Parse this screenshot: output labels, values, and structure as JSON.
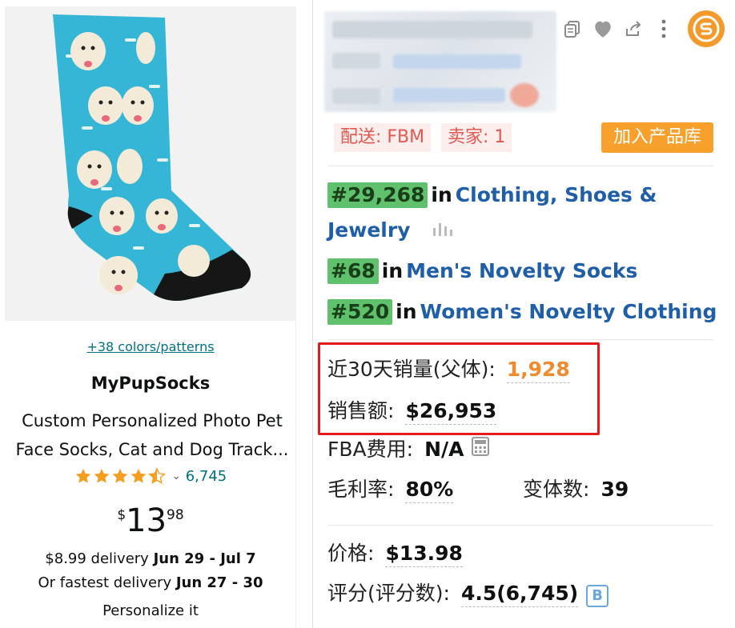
{
  "product": {
    "swatches_link": "+38 colors/patterns",
    "brand": "MyPupSocks",
    "title_line1": "Custom Personalized Photo Pet",
    "title_line2": "Face Socks, Cat and Dog Track...",
    "rating": 4.5,
    "review_count": "6,745",
    "price": {
      "currency": "$",
      "whole": "13",
      "fraction": "98"
    },
    "delivery": {
      "prefix": "$8.99 delivery ",
      "dates": "Jun 29 - Jul 7"
    },
    "fastest": {
      "prefix": "Or fastest delivery ",
      "dates": "Jun 27 - 30"
    },
    "personalize": "Personalize it"
  },
  "panel": {
    "tags": {
      "fulfillment": "配送: FBM",
      "sellers": "卖家: 1"
    },
    "add_button": "加入产品库",
    "ranks": [
      {
        "rank": "#29,268",
        "in": "in",
        "category_line1": "Clothing, Shoes &",
        "category_line2": "Jewelry"
      },
      {
        "rank": "#68",
        "in": "in",
        "category": "Men's Novelty Socks"
      },
      {
        "rank": "#520",
        "in": "in",
        "category": "Women's Novelty Clothing"
      }
    ],
    "stats": {
      "sales_30d_label": "近30天销量(父体):",
      "sales_30d_value": "1,928",
      "revenue_label": "销售额:",
      "revenue_value": "$26,953",
      "fba_fee_label": "FBA费用:",
      "fba_fee_value": "N/A",
      "margin_label": "毛利率:",
      "margin_value": "80%",
      "variants_label": "变体数:",
      "variants_value": "39",
      "price_label": "价格:",
      "price_value": "$13.98",
      "rating_label": "评分(评分数):",
      "rating_value": "4.5(6,745)",
      "rating_badge": "B"
    },
    "colors": {
      "accent_orange": "#f7a02c",
      "rank_green": "#5fc16b",
      "link_blue": "#1f5faa",
      "highlight_red": "#e31b1b"
    }
  }
}
